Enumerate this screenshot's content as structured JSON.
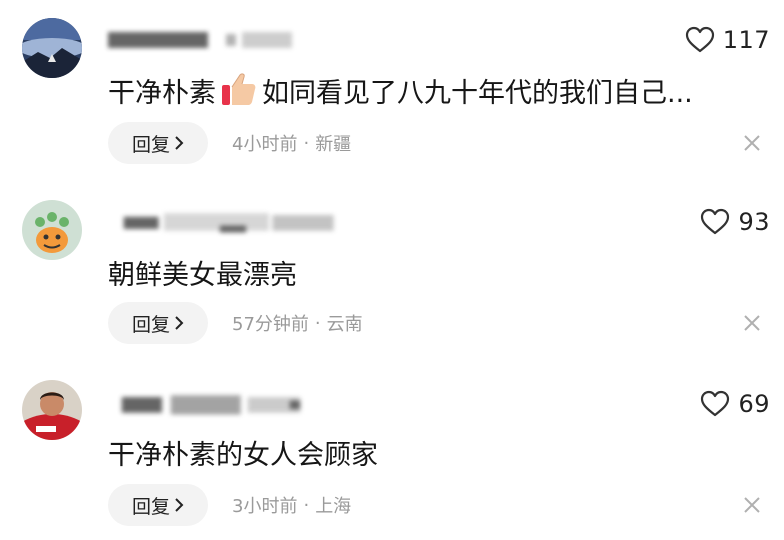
{
  "comments": [
    {
      "likes": "117",
      "text": "干净朴素",
      "text_after": "如同看见了八九十年代的我们自己...",
      "reply_label": "回复",
      "time": "4小时前",
      "location": "新疆"
    },
    {
      "likes": "93",
      "text": "朝鲜美女最漂亮",
      "text_after": "",
      "reply_label": "回复",
      "time": "57分钟前",
      "location": "云南"
    },
    {
      "likes": "69",
      "text": "干净朴素的女人会顾家",
      "text_after": "",
      "reply_label": "回复",
      "time": "3小时前",
      "location": "上海"
    }
  ],
  "meta_separator": "·",
  "colors": {
    "reply_bg": "#f3f3f3",
    "meta_text": "#9a9a9a",
    "icon_stroke": "#333333"
  },
  "icons": {
    "like": "heart-outline-icon",
    "close": "close-icon",
    "reply_arrow": "chevron-right-icon",
    "emoji": "thumbs-up-emoji"
  }
}
